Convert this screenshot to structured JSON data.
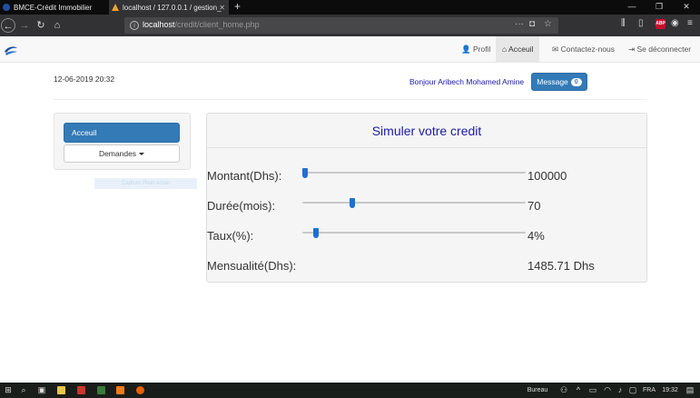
{
  "browser": {
    "tabs": [
      {
        "title": "BMCE-Crédit Immobilier",
        "active": false
      },
      {
        "title": "localhost / 127.0.0.1 / gestion_",
        "active": true
      }
    ],
    "new_tab": "+",
    "url_host": "localhost",
    "url_path": "/credit/client_home.php",
    "abp_label": "ABP"
  },
  "site_nav": {
    "links": [
      {
        "label": "Profil",
        "icon": "user-icon",
        "glyph": "👤"
      },
      {
        "label": "Acceuil",
        "icon": "home-icon",
        "glyph": "⌂"
      },
      {
        "label": "Contactez-nous",
        "icon": "envelope-icon",
        "glyph": "✉"
      },
      {
        "label": "Se déconnecter",
        "icon": "logout-icon",
        "glyph": "⇥"
      }
    ],
    "active": "Acceuil"
  },
  "header": {
    "datetime": "12-06-2019 20:32",
    "greeting": "Bonjour Aribech Mohamed Amine",
    "message_label": "Message",
    "message_count": "0"
  },
  "sidebar": {
    "home_label": "Acceuil",
    "requests_label": "Demandes"
  },
  "capture_overlay": "Capture Plein écran",
  "simulator": {
    "title": "Simuler votre credit",
    "rows": [
      {
        "label": "Montant(Dhs):",
        "value": "100000",
        "slider_fraction": 0.0
      },
      {
        "label": "Durée(mois):",
        "value": "70",
        "slider_fraction": 0.21
      },
      {
        "label": "Taux(%):",
        "value": "4%",
        "slider_fraction": 0.05
      },
      {
        "label": "Mensualité(Dhs):",
        "value": "1485.71 Dhs"
      }
    ]
  },
  "taskbar": {
    "label_bureau": "Bureau",
    "language": "FRA",
    "time": "19:32"
  },
  "colors": {
    "primary": "#337ab7",
    "title_blue": "#1a1aa8",
    "slider_thumb": "#1f6fd1"
  }
}
